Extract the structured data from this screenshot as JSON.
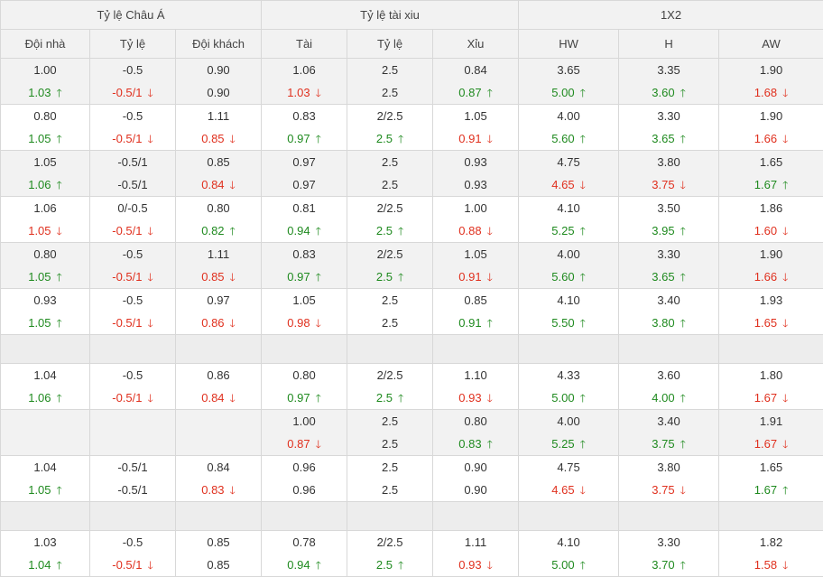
{
  "headers": {
    "groups": [
      "Tỷ lệ Châu Á",
      "Tỷ lệ tài xiu",
      "1X2"
    ],
    "columns": [
      "Đội nhà",
      "Tỷ lệ",
      "Đội khách",
      "Tài",
      "Tỷ lệ",
      "Xỉu",
      "HW",
      "H",
      "AW"
    ]
  },
  "arrow_up": "🡑",
  "arrow_down": "🡓",
  "rows": [
    {
      "type": "data",
      "shade": true,
      "cells": [
        {
          "top": "1.00",
          "bottom": "1.03",
          "dir": "up"
        },
        {
          "top": "-0.5",
          "bottom": "-0.5/1",
          "dir": "down"
        },
        {
          "top": "0.90",
          "bottom": "0.90",
          "dir": ""
        },
        {
          "top": "1.06",
          "bottom": "1.03",
          "dir": "down"
        },
        {
          "top": "2.5",
          "bottom": "2.5",
          "dir": ""
        },
        {
          "top": "0.84",
          "bottom": "0.87",
          "dir": "up"
        },
        {
          "top": "3.65",
          "bottom": "5.00",
          "dir": "up"
        },
        {
          "top": "3.35",
          "bottom": "3.60",
          "dir": "up"
        },
        {
          "top": "1.90",
          "bottom": "1.68",
          "dir": "down"
        }
      ]
    },
    {
      "type": "data",
      "shade": false,
      "cells": [
        {
          "top": "0.80",
          "bottom": "1.05",
          "dir": "up"
        },
        {
          "top": "-0.5",
          "bottom": "-0.5/1",
          "dir": "down"
        },
        {
          "top": "1.11",
          "bottom": "0.85",
          "dir": "down"
        },
        {
          "top": "0.83",
          "bottom": "0.97",
          "dir": "up"
        },
        {
          "top": "2/2.5",
          "bottom": "2.5",
          "dir": "up"
        },
        {
          "top": "1.05",
          "bottom": "0.91",
          "dir": "down"
        },
        {
          "top": "4.00",
          "bottom": "5.60",
          "dir": "up"
        },
        {
          "top": "3.30",
          "bottom": "3.65",
          "dir": "up"
        },
        {
          "top": "1.90",
          "bottom": "1.66",
          "dir": "down"
        }
      ]
    },
    {
      "type": "data",
      "shade": true,
      "cells": [
        {
          "top": "1.05",
          "bottom": "1.06",
          "dir": "up"
        },
        {
          "top": "-0.5/1",
          "bottom": "-0.5/1",
          "dir": ""
        },
        {
          "top": "0.85",
          "bottom": "0.84",
          "dir": "down"
        },
        {
          "top": "0.97",
          "bottom": "0.97",
          "dir": ""
        },
        {
          "top": "2.5",
          "bottom": "2.5",
          "dir": ""
        },
        {
          "top": "0.93",
          "bottom": "0.93",
          "dir": ""
        },
        {
          "top": "4.75",
          "bottom": "4.65",
          "dir": "down"
        },
        {
          "top": "3.80",
          "bottom": "3.75",
          "dir": "down"
        },
        {
          "top": "1.65",
          "bottom": "1.67",
          "dir": "up"
        }
      ]
    },
    {
      "type": "data",
      "shade": false,
      "cells": [
        {
          "top": "1.06",
          "bottom": "1.05",
          "dir": "down"
        },
        {
          "top": "0/-0.5",
          "bottom": "-0.5/1",
          "dir": "down"
        },
        {
          "top": "0.80",
          "bottom": "0.82",
          "dir": "up"
        },
        {
          "top": "0.81",
          "bottom": "0.94",
          "dir": "up"
        },
        {
          "top": "2/2.5",
          "bottom": "2.5",
          "dir": "up"
        },
        {
          "top": "1.00",
          "bottom": "0.88",
          "dir": "down"
        },
        {
          "top": "4.10",
          "bottom": "5.25",
          "dir": "up"
        },
        {
          "top": "3.50",
          "bottom": "3.95",
          "dir": "up"
        },
        {
          "top": "1.86",
          "bottom": "1.60",
          "dir": "down"
        }
      ]
    },
    {
      "type": "data",
      "shade": true,
      "cells": [
        {
          "top": "0.80",
          "bottom": "1.05",
          "dir": "up"
        },
        {
          "top": "-0.5",
          "bottom": "-0.5/1",
          "dir": "down"
        },
        {
          "top": "1.11",
          "bottom": "0.85",
          "dir": "down"
        },
        {
          "top": "0.83",
          "bottom": "0.97",
          "dir": "up"
        },
        {
          "top": "2/2.5",
          "bottom": "2.5",
          "dir": "up"
        },
        {
          "top": "1.05",
          "bottom": "0.91",
          "dir": "down"
        },
        {
          "top": "4.00",
          "bottom": "5.60",
          "dir": "up"
        },
        {
          "top": "3.30",
          "bottom": "3.65",
          "dir": "up"
        },
        {
          "top": "1.90",
          "bottom": "1.66",
          "dir": "down"
        }
      ]
    },
    {
      "type": "data",
      "shade": false,
      "cells": [
        {
          "top": "0.93",
          "bottom": "1.05",
          "dir": "up"
        },
        {
          "top": "-0.5",
          "bottom": "-0.5/1",
          "dir": "down"
        },
        {
          "top": "0.97",
          "bottom": "0.86",
          "dir": "down"
        },
        {
          "top": "1.05",
          "bottom": "0.98",
          "dir": "down"
        },
        {
          "top": "2.5",
          "bottom": "2.5",
          "dir": ""
        },
        {
          "top": "0.85",
          "bottom": "0.91",
          "dir": "up"
        },
        {
          "top": "4.10",
          "bottom": "5.50",
          "dir": "up"
        },
        {
          "top": "3.40",
          "bottom": "3.80",
          "dir": "up"
        },
        {
          "top": "1.93",
          "bottom": "1.65",
          "dir": "down"
        }
      ]
    },
    {
      "type": "gap"
    },
    {
      "type": "data",
      "shade": false,
      "cells": [
        {
          "top": "1.04",
          "bottom": "1.06",
          "dir": "up"
        },
        {
          "top": "-0.5",
          "bottom": "-0.5/1",
          "dir": "down"
        },
        {
          "top": "0.86",
          "bottom": "0.84",
          "dir": "down"
        },
        {
          "top": "0.80",
          "bottom": "0.97",
          "dir": "up"
        },
        {
          "top": "2/2.5",
          "bottom": "2.5",
          "dir": "up"
        },
        {
          "top": "1.10",
          "bottom": "0.93",
          "dir": "down"
        },
        {
          "top": "4.33",
          "bottom": "5.00",
          "dir": "up"
        },
        {
          "top": "3.60",
          "bottom": "4.00",
          "dir": "up"
        },
        {
          "top": "1.80",
          "bottom": "1.67",
          "dir": "down"
        }
      ]
    },
    {
      "type": "data",
      "shade": true,
      "cells": [
        {
          "top": "",
          "bottom": "",
          "dir": ""
        },
        {
          "top": "",
          "bottom": "",
          "dir": ""
        },
        {
          "top": "",
          "bottom": "",
          "dir": ""
        },
        {
          "top": "1.00",
          "bottom": "0.87",
          "dir": "down"
        },
        {
          "top": "2.5",
          "bottom": "2.5",
          "dir": ""
        },
        {
          "top": "0.80",
          "bottom": "0.83",
          "dir": "up"
        },
        {
          "top": "4.00",
          "bottom": "5.25",
          "dir": "up"
        },
        {
          "top": "3.40",
          "bottom": "3.75",
          "dir": "up"
        },
        {
          "top": "1.91",
          "bottom": "1.67",
          "dir": "down"
        }
      ]
    },
    {
      "type": "data",
      "shade": false,
      "cells": [
        {
          "top": "1.04",
          "bottom": "1.05",
          "dir": "up"
        },
        {
          "top": "-0.5/1",
          "bottom": "-0.5/1",
          "dir": ""
        },
        {
          "top": "0.84",
          "bottom": "0.83",
          "dir": "down"
        },
        {
          "top": "0.96",
          "bottom": "0.96",
          "dir": ""
        },
        {
          "top": "2.5",
          "bottom": "2.5",
          "dir": ""
        },
        {
          "top": "0.90",
          "bottom": "0.90",
          "dir": ""
        },
        {
          "top": "4.75",
          "bottom": "4.65",
          "dir": "down"
        },
        {
          "top": "3.80",
          "bottom": "3.75",
          "dir": "down"
        },
        {
          "top": "1.65",
          "bottom": "1.67",
          "dir": "up"
        }
      ]
    },
    {
      "type": "gap"
    },
    {
      "type": "data",
      "shade": false,
      "cells": [
        {
          "top": "1.03",
          "bottom": "1.04",
          "dir": "up"
        },
        {
          "top": "-0.5",
          "bottom": "-0.5/1",
          "dir": "down"
        },
        {
          "top": "0.85",
          "bottom": "0.85",
          "dir": ""
        },
        {
          "top": "0.78",
          "bottom": "0.94",
          "dir": "up"
        },
        {
          "top": "2/2.5",
          "bottom": "2.5",
          "dir": "up"
        },
        {
          "top": "1.11",
          "bottom": "0.93",
          "dir": "down"
        },
        {
          "top": "4.10",
          "bottom": "5.00",
          "dir": "up"
        },
        {
          "top": "3.30",
          "bottom": "3.70",
          "dir": "up"
        },
        {
          "top": "1.82",
          "bottom": "1.58",
          "dir": "down"
        }
      ]
    }
  ]
}
